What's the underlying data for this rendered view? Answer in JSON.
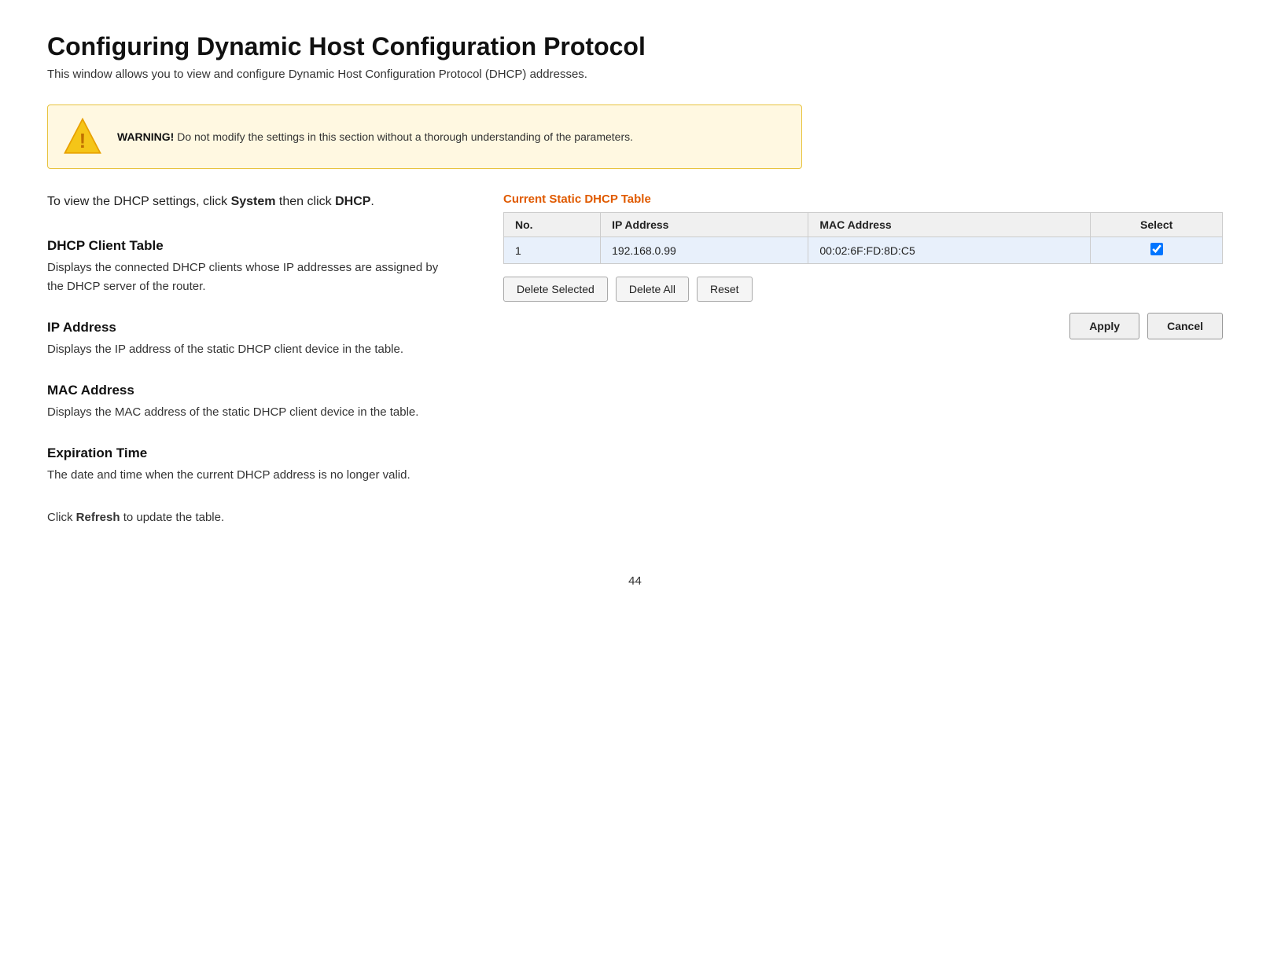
{
  "page": {
    "title": "Configuring Dynamic Host Configuration Protocol",
    "subtitle": "This window allows you to view and configure Dynamic Host Configuration Protocol (DHCP) addresses.",
    "page_number": "44"
  },
  "warning": {
    "label": "WARNING!",
    "text": "Do not modify the settings in this section without a thorough understanding of the parameters."
  },
  "intro": {
    "text_before_system": "To view the DHCP settings, click ",
    "system_label": "System",
    "text_between": " then click ",
    "dhcp_label": "DHCP",
    "text_after": "."
  },
  "sections": [
    {
      "id": "dhcp-client-table",
      "title": "DHCP Client Table",
      "body": "Displays the connected DHCP clients whose IP addresses are assigned by the DHCP server of the router."
    },
    {
      "id": "ip-address",
      "title": "IP Address",
      "body": "Displays the IP address of the static DHCP client device in the table."
    },
    {
      "id": "mac-address",
      "title": "MAC Address",
      "body": "Displays the MAC address of the static DHCP client device in the table."
    },
    {
      "id": "expiration-time",
      "title": "Expiration Time",
      "body": "The date and time when the current DHCP address is no longer valid."
    }
  ],
  "refresh_text_before": "Click ",
  "refresh_bold": "Refresh",
  "refresh_text_after": " to update the table.",
  "table": {
    "title": "Current Static DHCP Table",
    "headers": [
      "No.",
      "IP Address",
      "MAC Address",
      "Select"
    ],
    "rows": [
      {
        "no": "1",
        "ip": "192.168.0.99",
        "mac": "00:02:6F:FD:8D:C5",
        "selected": true
      }
    ]
  },
  "buttons": {
    "delete_selected": "Delete Selected",
    "delete_all": "Delete All",
    "reset": "Reset",
    "apply": "Apply",
    "cancel": "Cancel"
  }
}
